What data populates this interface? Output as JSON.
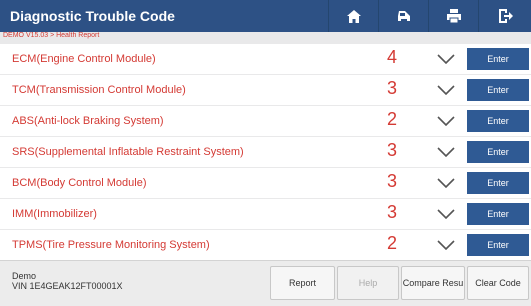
{
  "header": {
    "title": "Diagnostic Trouble Code",
    "icons": [
      "home-icon",
      "car-icon",
      "printer-icon",
      "exit-icon"
    ]
  },
  "breadcrumb": "DEMO V15.03 > Health Report",
  "systems": [
    {
      "name": "ECM(Engine Control Module)",
      "count": "4",
      "action": "Enter"
    },
    {
      "name": "TCM(Transmission Control Module)",
      "count": "3",
      "action": "Enter"
    },
    {
      "name": "ABS(Anti-lock Braking System)",
      "count": "2",
      "action": "Enter"
    },
    {
      "name": "SRS(Supplemental Inflatable Restraint System)",
      "count": "3",
      "action": "Enter"
    },
    {
      "name": "BCM(Body Control Module)",
      "count": "3",
      "action": "Enter"
    },
    {
      "name": "IMM(Immobilizer)",
      "count": "3",
      "action": "Enter"
    },
    {
      "name": "TPMS(Tire Pressure Monitoring System)",
      "count": "2",
      "action": "Enter"
    }
  ],
  "footer": {
    "demo": "Demo",
    "vin": "VIN 1E4GEAK12FT00001X",
    "buttons": {
      "report": "Report",
      "help": "Help",
      "compare": "Compare Resu",
      "clear": "Clear Code"
    }
  },
  "colors": {
    "header": "#2d5185",
    "accent_red": "#d43a34",
    "enter_button": "#2f5a94",
    "background": "#e9e9ea"
  }
}
